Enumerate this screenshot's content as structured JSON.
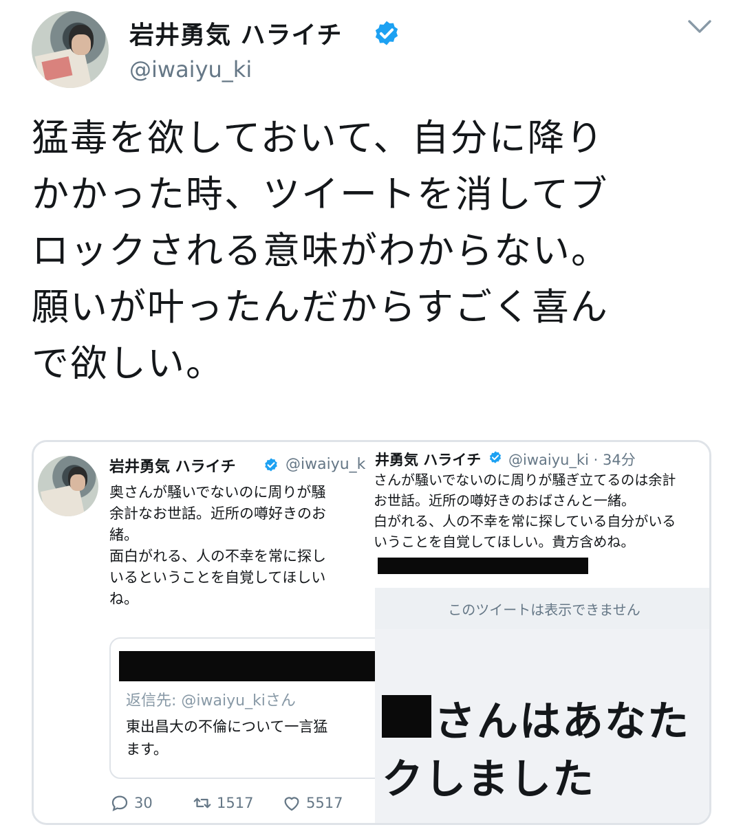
{
  "tweet": {
    "display_name": "岩井勇気 ハライチ",
    "handle": "@iwaiyu_ki",
    "text": "猛毒を欲しておいて、自分に降り\nかかった時、ツイートを消してブ\nロックされる意味がわからない。\n願いが叶ったんだからすごく喜ん\nで欲しい。"
  },
  "icons": {
    "verified": "verified-badge-icon",
    "more": "chevron-down-icon",
    "reply": "reply-icon",
    "retweet": "retweet-icon",
    "like": "like-icon"
  },
  "colors": {
    "verified_blue": "#1da1f2",
    "secondary_text": "#657786"
  },
  "embedded": {
    "left": {
      "display_name": "岩井勇気 ハライチ",
      "handle": "@iwaiyu_k",
      "body": "奥さんが騒いでないのに周りが騒\n余計なお世話。近所の噂好きのお\n緒。\n面白がれる、人の不幸を常に探し\nいるということを自覚してほしい\nね。",
      "quote": {
        "reply_to": "返信先: @iwaiyu_kiさん",
        "body": "東出昌大の不倫について一言猛\nます。"
      },
      "stats": {
        "replies": "30",
        "retweets": "1517",
        "likes": "5517"
      }
    },
    "right": {
      "display_name": "井勇気 ハライチ",
      "meta": "@iwaiyu_ki · 34分",
      "body": "さんが騒いでないのに周りが騒ぎ立てるのは余計\nお世話。近所の噂好きのおばさんと一緒。\n白がれる、人の不幸を常に探している自分がいる\nいうことを自覚してほしい。貴方含めね。",
      "unavailable": "このツイートは表示できません",
      "block_line1": "さんはあなた",
      "block_line2": "クしました"
    }
  }
}
